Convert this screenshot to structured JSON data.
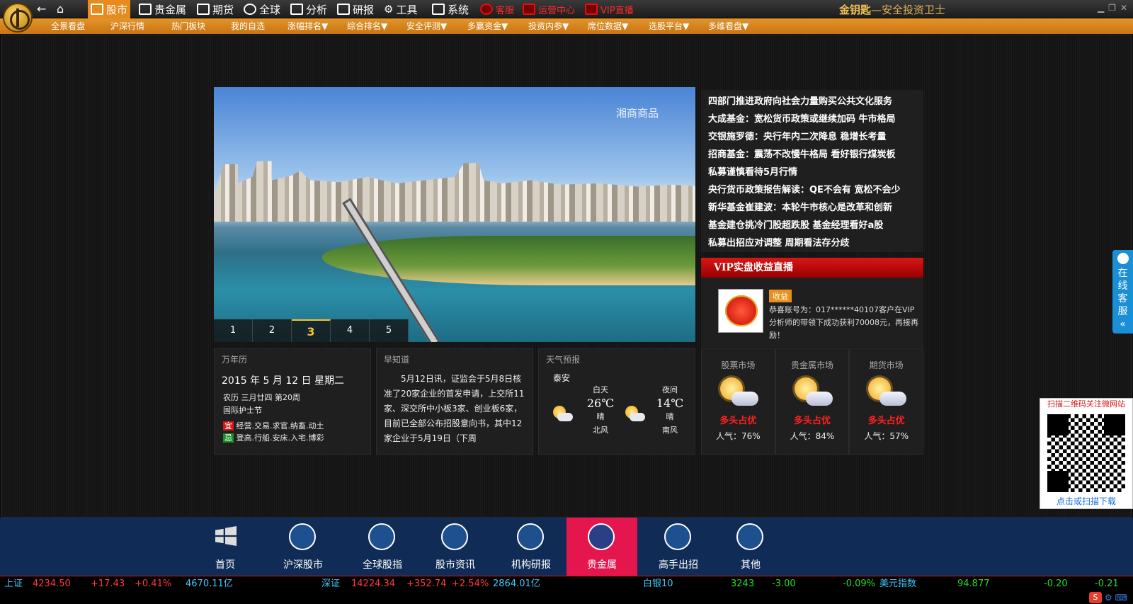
{
  "topbar": {
    "nav": [
      {
        "label": "股市",
        "icon": "chart-icon"
      },
      {
        "label": "贵金属",
        "icon": "gold-bars-icon"
      },
      {
        "label": "期货",
        "icon": "line-chart-icon"
      },
      {
        "label": "全球",
        "icon": "globe-icon"
      },
      {
        "label": "分析",
        "icon": "document-icon"
      },
      {
        "label": "研报",
        "icon": "report-icon"
      },
      {
        "label": "工具",
        "icon": "gear-icon"
      },
      {
        "label": "系统",
        "icon": "cube-icon"
      },
      {
        "label": "客服",
        "icon": "service-icon"
      },
      {
        "label": "运营中心",
        "icon": "operations-icon"
      },
      {
        "label": "VIP直播",
        "icon": "vip-icon"
      }
    ],
    "brand_name": "金钥匙",
    "brand_slogan": "—安全投资卫士"
  },
  "subnav": [
    "全景看盘",
    "沪深行情",
    "热门板块",
    "我的自选",
    "涨幅排名▼",
    "综合排名▼",
    "安全评测▼",
    "多赢资金▼",
    "投资内参▼",
    "席位数据▼",
    "选股平台▼",
    "多维看盘▼"
  ],
  "banner": {
    "watermark": "湘商商品",
    "pages": [
      "1",
      "2",
      "3",
      "4",
      "5"
    ],
    "active_page": "3"
  },
  "news": [
    "四部门推进政府向社会力量购买公共文化服务",
    "大成基金：宽松货币政策或继续加码 牛市格局",
    "交银施罗德：央行年内二次降息 稳增长考量",
    "招商基金：震荡不改慢牛格局 看好银行煤炭板",
    "私募谨慎看待5月行情",
    "央行货币政策报告解读：QE不会有 宽松不会少",
    "新华基金崔建波：本轮牛市核心是改革和创新",
    "基金建仓挑冷门股超跌股 基金经理看好a股",
    "私募出招应对调整 周期看法存分歧"
  ],
  "vip": {
    "title": "VIP实盘收益直播",
    "tag": "收益",
    "message": "恭喜账号为：017******40107客户在VIP分析师的带领下成功获利70008元，再接再励！"
  },
  "calendar": {
    "title": "万年历",
    "date": "2015 年 5 月 12 日 星期二",
    "lunar": "农历 三月廿四 第20周",
    "festival": "国际护士节",
    "yi_label": "宜",
    "yi": "经营.交易.求官.纳畜.动土",
    "ji_label": "忌",
    "ji": "登高.行船.安床.入宅.博彩"
  },
  "morning_news": {
    "title": "早知道",
    "text": "5月12日讯，证监会于5月8日核准了20家企业的首发申请，上交所11家、深交所中小板3家、创业板6家，目前已全部公布招股意向书，其中12家企业于5月19日（下周"
  },
  "weather": {
    "title": "天气预报",
    "city": "泰安",
    "day": {
      "label": "白天",
      "temp": "26℃",
      "cond": "晴",
      "wind": "北风"
    },
    "night": {
      "label": "夜间",
      "temp": "14℃",
      "cond": "晴",
      "wind": "南风"
    }
  },
  "markets": [
    {
      "title": "股票市场",
      "status": "多头占优",
      "popularity": "人气：76%"
    },
    {
      "title": "贵金属市场",
      "status": "多头占优",
      "popularity": "人气：84%"
    },
    {
      "title": "期货市场",
      "status": "多头占优",
      "popularity": "人气：57%"
    }
  ],
  "service": {
    "label_chars": [
      "在",
      "线",
      "客",
      "服"
    ],
    "collapse": "«"
  },
  "qr": {
    "title": "扫描二维码关注微网站",
    "footer": "点击或扫描下载"
  },
  "dock": [
    {
      "label": "首页",
      "icon": "windows-icon"
    },
    {
      "label": "沪深股市",
      "icon": "bar-chart-icon"
    },
    {
      "label": "全球股指",
      "icon": "globe-icon"
    },
    {
      "label": "股市资讯",
      "icon": "area-chart-icon"
    },
    {
      "label": "机构研报",
      "icon": "list-icon"
    },
    {
      "label": "贵金属",
      "icon": "document-chart-icon"
    },
    {
      "label": "高手出招",
      "icon": "presentation-icon"
    },
    {
      "label": "其他",
      "icon": "grid-list-icon"
    }
  ],
  "dock_active": "贵金属",
  "ticker": {
    "sh_name": "上证",
    "sh_price": "4234.50",
    "sh_change": "+17.43",
    "sh_pct": "+0.41%",
    "sh_vol": "4670.11亿",
    "sz_name": "深证",
    "sz_price": "14224.34",
    "sz_change": "+352.74",
    "sz_pct": "+2.54%",
    "sz_vol": "2864.01亿",
    "ag_name": "白银10",
    "ag_price": "3243",
    "ag_change": "-3.00",
    "ag_pct": "-0.09%",
    "usd_name": "美元指数",
    "usd_price": "94.877",
    "usd_change": "-0.20",
    "usd_pct": "-0.21"
  },
  "colors": {
    "accent": "#e88a1e",
    "dock_bg": "#102b55",
    "dock_active": "#e4164d",
    "up": "#ff3a3a",
    "down": "#22dd22"
  }
}
